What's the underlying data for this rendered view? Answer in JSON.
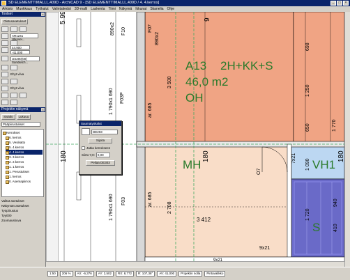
{
  "window": {
    "title": "SD ELEMENTTIMALLI_409D - ArchiCAD 9 - [SD ELEMENTTIMALLI_409D / 4. 4.kerros]",
    "buttons": [
      "_",
      "□",
      "×"
    ]
  },
  "menu": [
    "Arkisto",
    "Muokkaus",
    "Työkalut",
    "Valintatiedot",
    "3D-malli",
    "Laskenta",
    "Tiimi",
    "Näkymä",
    "Ikkunat",
    "Skanelia",
    "Ohje"
  ],
  "toolbox": {
    "title": "Toolset",
    "settings_label": "Oletusasetukset",
    "wall_type": "AR1241 Ulkosei...",
    "num1": "44,900",
    "num2": "-41,000",
    "slab_type": "US200(00) Sandwich...",
    "label_a": "Ehyt viiva",
    "label_b": "Ehyt viiva"
  },
  "navigator": {
    "title": "Projektin näkymä",
    "tab1": "Sisältö",
    "tab2": "Lukuuu",
    "header": "Pääpiirustukset",
    "items": [
      "Kerrokset",
      "6. kerros",
      "5. Vesikatto",
      "5. 4.kerros",
      "4. 4.kerros",
      "3. 3.kerros",
      "2. 2.kerros",
      "1. 1.kerros",
      "1. Perustukset",
      "1. kerros",
      "0. Asemapiirros"
    ],
    "footer1": "Valitut asetukset",
    "footer2": "Näkymän asetukset",
    "footer3": "Työpiirustus",
    "footer4": "Tyy000",
    "footer5": "Zoomauskuva"
  },
  "dialog": {
    "title": "Saumatyökalut",
    "field": "DE203",
    "btn1": "Sijoita",
    "check": "Jatka kerrokseen",
    "label": "Siirto Y,0:",
    "value": "0,00",
    "btn2": "Peilaa DE303"
  },
  "canvas": {
    "room1_code": "A13",
    "room1_type": "2H+KK+S",
    "room1_area": "46,0 m2",
    "room1_floor": "OH",
    "room2_name": "MH",
    "room3_name": "VH1",
    "room4_name": "S",
    "dim_5990": "5 990",
    "dim_890x2_a": "890x2",
    "dim_f10": "F10",
    "dim_f07": "F07",
    "dim_890x2_b": "890x2",
    "dim_9": "9",
    "dim_3500": "3 500",
    "dim_1790x1690_a": "1 790x1 690",
    "dim_f03p": "F03P",
    "dim_ar685_a": "ar. 685",
    "dim_180_a": "180",
    "dim_180_b": "180",
    "dim_180_c": "180",
    "dim_1790x1690_b": "1 790x1 690",
    "dim_f03": "F03",
    "dim_ar685_b": "ar. 685",
    "dim_2708": "2 708",
    "dim_3412": "3 412",
    "dim_9x21_a": "9x21",
    "dim_9x21_b": "9x21",
    "dim_7x21": "7x21",
    "dim_o7": "O7",
    "dim_1090": "1 090",
    "dim_1720": "1 720",
    "dim_698": "698",
    "dim_1250": "1 250",
    "dim_650": "650",
    "dim_1770": "1 770",
    "dim_940": "940",
    "dim_410": "410"
  },
  "status": {
    "scale": "1:50",
    "zoom": "206 %",
    "ax": "AX: -6,376",
    "ay": "AY: 2,502",
    "rx": "RX: 8,772",
    "ra": "R: 107,38°",
    "pz": "AV: 41,000",
    "proj": "Projektin nolla",
    "pa": "Pintavalikko"
  },
  "colors": {
    "room_orange": "#f0a484",
    "room_peach": "#f9ddc8",
    "room_blue": "#6a6ac8",
    "grid_green": "#40a860",
    "title_blue": "#0a246a"
  }
}
